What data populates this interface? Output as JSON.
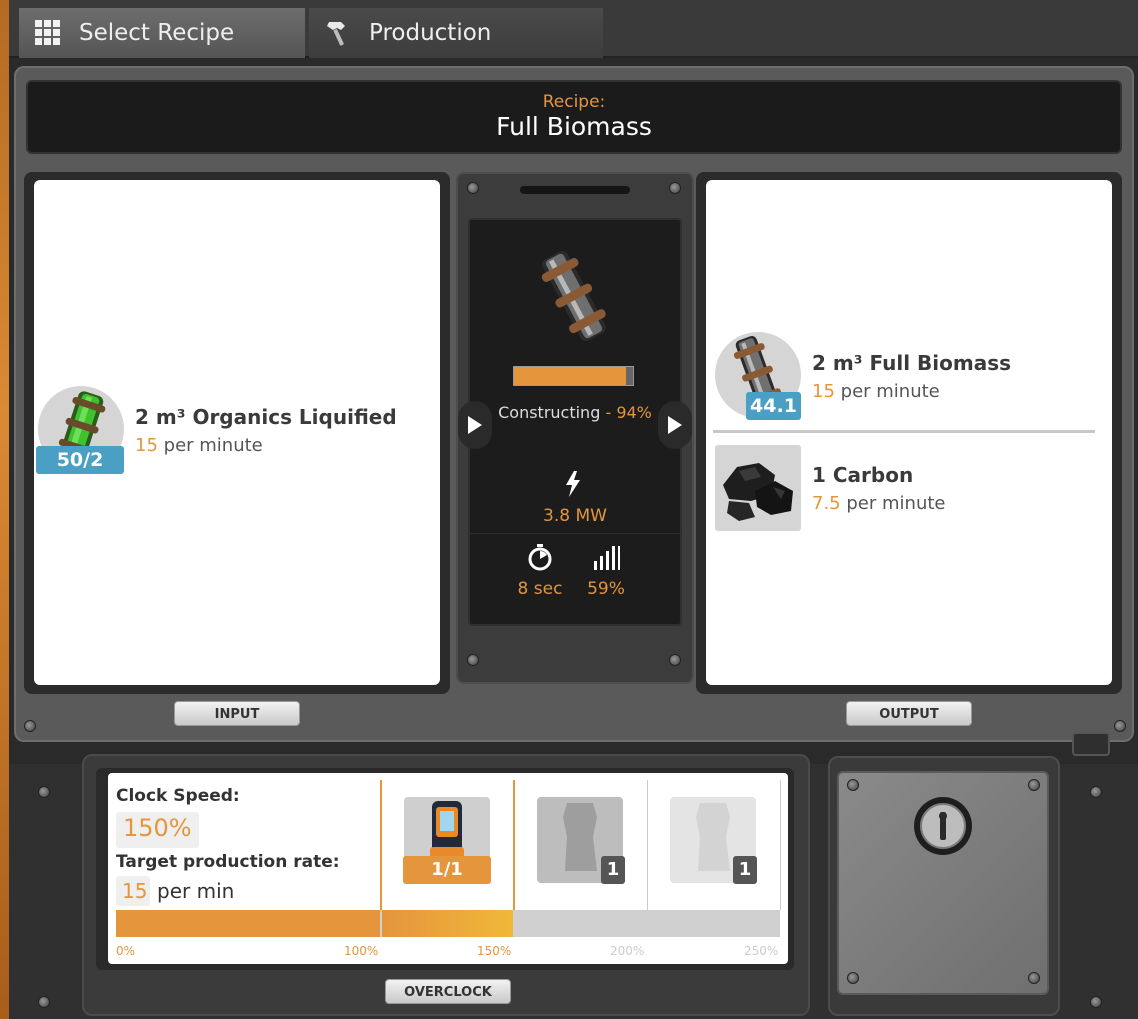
{
  "tabs": [
    {
      "label": "Select Recipe",
      "icon": "grid-icon",
      "active": true
    },
    {
      "label": "Production",
      "icon": "hammer-icon",
      "active": false
    }
  ],
  "recipe": {
    "label": "Recipe:",
    "name": "Full Biomass"
  },
  "input": {
    "tag": "INPUT",
    "items": [
      {
        "name": "2 m³ Organics Liquified",
        "rate_value": "15",
        "rate_unit": "per minute",
        "count": "50/2",
        "icon": "organics-canister-icon"
      }
    ]
  },
  "output": {
    "tag": "OUTPUT",
    "items": [
      {
        "name": "2 m³ Full Biomass",
        "rate_value": "15",
        "rate_unit": "per minute",
        "count": "44.1",
        "icon": "biomass-canister-icon"
      },
      {
        "name": "1 Carbon",
        "rate_value": "7.5",
        "rate_unit": "per minute",
        "icon": "carbon-icon"
      }
    ]
  },
  "machine": {
    "progress": 0.94,
    "status_label": "Constructing",
    "status_sep": " - ",
    "status_pct": "94%",
    "power": "3.8 MW",
    "cycle_time": "8 sec",
    "efficiency": "59%"
  },
  "overclock": {
    "tag": "OVERCLOCK",
    "clock_label": "Clock Speed:",
    "clock_value": "150%",
    "target_label": "Target production rate:",
    "target_value": "15",
    "target_unit": "per min",
    "fill_fraction": 0.6,
    "shards": [
      {
        "count": "1/1",
        "state": "inserted"
      },
      {
        "count": "1",
        "state": "empty"
      },
      {
        "count": "1",
        "state": "empty-faded"
      }
    ],
    "scale": [
      "0%",
      "100%",
      "150%",
      "200%",
      "250%"
    ]
  },
  "colors": {
    "accent": "#e5953c",
    "badge_blue": "#4a9fc4",
    "panel": "#5a5a5a"
  }
}
